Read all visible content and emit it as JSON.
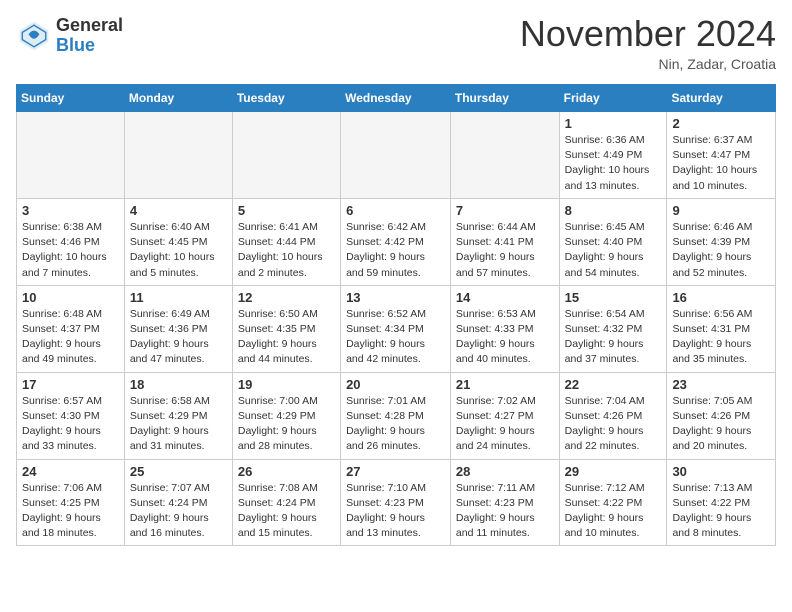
{
  "logo": {
    "general": "General",
    "blue": "Blue"
  },
  "title": "November 2024",
  "subtitle": "Nin, Zadar, Croatia",
  "days_header": [
    "Sunday",
    "Monday",
    "Tuesday",
    "Wednesday",
    "Thursday",
    "Friday",
    "Saturday"
  ],
  "weeks": [
    [
      {
        "day": "",
        "info": ""
      },
      {
        "day": "",
        "info": ""
      },
      {
        "day": "",
        "info": ""
      },
      {
        "day": "",
        "info": ""
      },
      {
        "day": "",
        "info": ""
      },
      {
        "day": "1",
        "info": "Sunrise: 6:36 AM\nSunset: 4:49 PM\nDaylight: 10 hours and 13 minutes."
      },
      {
        "day": "2",
        "info": "Sunrise: 6:37 AM\nSunset: 4:47 PM\nDaylight: 10 hours and 10 minutes."
      }
    ],
    [
      {
        "day": "3",
        "info": "Sunrise: 6:38 AM\nSunset: 4:46 PM\nDaylight: 10 hours and 7 minutes."
      },
      {
        "day": "4",
        "info": "Sunrise: 6:40 AM\nSunset: 4:45 PM\nDaylight: 10 hours and 5 minutes."
      },
      {
        "day": "5",
        "info": "Sunrise: 6:41 AM\nSunset: 4:44 PM\nDaylight: 10 hours and 2 minutes."
      },
      {
        "day": "6",
        "info": "Sunrise: 6:42 AM\nSunset: 4:42 PM\nDaylight: 9 hours and 59 minutes."
      },
      {
        "day": "7",
        "info": "Sunrise: 6:44 AM\nSunset: 4:41 PM\nDaylight: 9 hours and 57 minutes."
      },
      {
        "day": "8",
        "info": "Sunrise: 6:45 AM\nSunset: 4:40 PM\nDaylight: 9 hours and 54 minutes."
      },
      {
        "day": "9",
        "info": "Sunrise: 6:46 AM\nSunset: 4:39 PM\nDaylight: 9 hours and 52 minutes."
      }
    ],
    [
      {
        "day": "10",
        "info": "Sunrise: 6:48 AM\nSunset: 4:37 PM\nDaylight: 9 hours and 49 minutes."
      },
      {
        "day": "11",
        "info": "Sunrise: 6:49 AM\nSunset: 4:36 PM\nDaylight: 9 hours and 47 minutes."
      },
      {
        "day": "12",
        "info": "Sunrise: 6:50 AM\nSunset: 4:35 PM\nDaylight: 9 hours and 44 minutes."
      },
      {
        "day": "13",
        "info": "Sunrise: 6:52 AM\nSunset: 4:34 PM\nDaylight: 9 hours and 42 minutes."
      },
      {
        "day": "14",
        "info": "Sunrise: 6:53 AM\nSunset: 4:33 PM\nDaylight: 9 hours and 40 minutes."
      },
      {
        "day": "15",
        "info": "Sunrise: 6:54 AM\nSunset: 4:32 PM\nDaylight: 9 hours and 37 minutes."
      },
      {
        "day": "16",
        "info": "Sunrise: 6:56 AM\nSunset: 4:31 PM\nDaylight: 9 hours and 35 minutes."
      }
    ],
    [
      {
        "day": "17",
        "info": "Sunrise: 6:57 AM\nSunset: 4:30 PM\nDaylight: 9 hours and 33 minutes."
      },
      {
        "day": "18",
        "info": "Sunrise: 6:58 AM\nSunset: 4:29 PM\nDaylight: 9 hours and 31 minutes."
      },
      {
        "day": "19",
        "info": "Sunrise: 7:00 AM\nSunset: 4:29 PM\nDaylight: 9 hours and 28 minutes."
      },
      {
        "day": "20",
        "info": "Sunrise: 7:01 AM\nSunset: 4:28 PM\nDaylight: 9 hours and 26 minutes."
      },
      {
        "day": "21",
        "info": "Sunrise: 7:02 AM\nSunset: 4:27 PM\nDaylight: 9 hours and 24 minutes."
      },
      {
        "day": "22",
        "info": "Sunrise: 7:04 AM\nSunset: 4:26 PM\nDaylight: 9 hours and 22 minutes."
      },
      {
        "day": "23",
        "info": "Sunrise: 7:05 AM\nSunset: 4:26 PM\nDaylight: 9 hours and 20 minutes."
      }
    ],
    [
      {
        "day": "24",
        "info": "Sunrise: 7:06 AM\nSunset: 4:25 PM\nDaylight: 9 hours and 18 minutes."
      },
      {
        "day": "25",
        "info": "Sunrise: 7:07 AM\nSunset: 4:24 PM\nDaylight: 9 hours and 16 minutes."
      },
      {
        "day": "26",
        "info": "Sunrise: 7:08 AM\nSunset: 4:24 PM\nDaylight: 9 hours and 15 minutes."
      },
      {
        "day": "27",
        "info": "Sunrise: 7:10 AM\nSunset: 4:23 PM\nDaylight: 9 hours and 13 minutes."
      },
      {
        "day": "28",
        "info": "Sunrise: 7:11 AM\nSunset: 4:23 PM\nDaylight: 9 hours and 11 minutes."
      },
      {
        "day": "29",
        "info": "Sunrise: 7:12 AM\nSunset: 4:22 PM\nDaylight: 9 hours and 10 minutes."
      },
      {
        "day": "30",
        "info": "Sunrise: 7:13 AM\nSunset: 4:22 PM\nDaylight: 9 hours and 8 minutes."
      }
    ]
  ]
}
